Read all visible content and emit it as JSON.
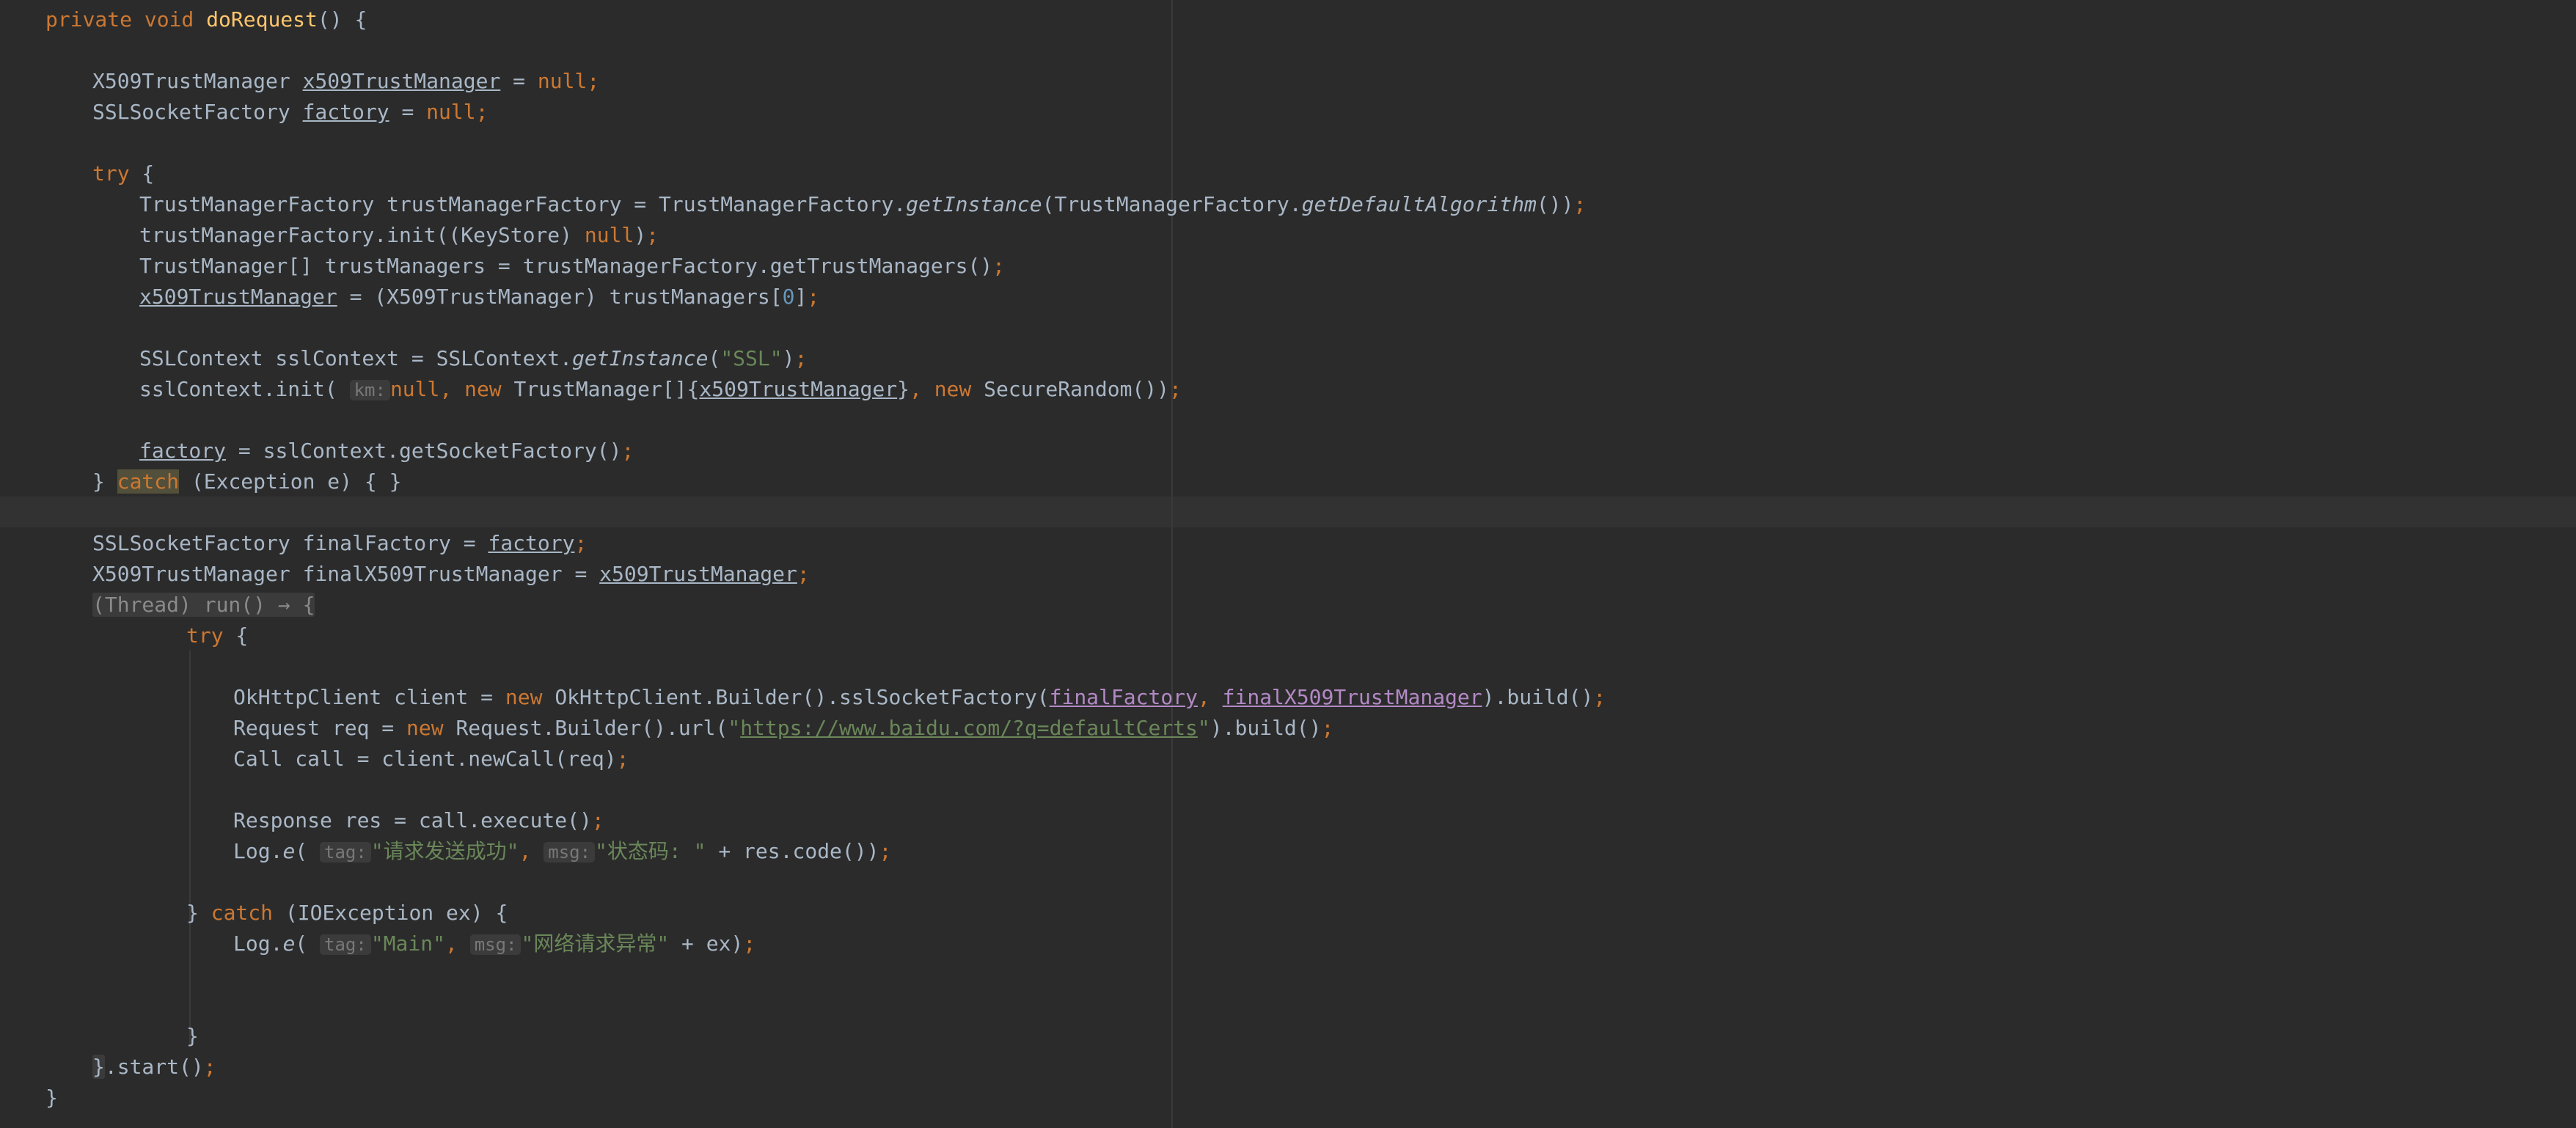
{
  "colors": {
    "background": "#2b2b2b",
    "keyword": "#cc7832",
    "method_decl": "#ffc66d",
    "string": "#6a8759",
    "number": "#6897bb",
    "plain": "#a9b7c6",
    "param_hint": "#787878"
  },
  "code": {
    "l01": {
      "kw": "private void ",
      "fn": "doRequest",
      "rest": "() {"
    },
    "l02": {
      "type": "X509TrustManager ",
      "var": "x509TrustManager",
      "eq": " = ",
      "null": "null",
      "semi": ";"
    },
    "l03": {
      "type": "SSLSocketFactory ",
      "var": "factory",
      "eq": " = ",
      "null": "null",
      "semi": ";"
    },
    "l04": {
      "kw": "try",
      "rest": " {"
    },
    "l05": {
      "a": "TrustManagerFactory trustManagerFactory = TrustManagerFactory.",
      "m1": "getInstance",
      "b": "(TrustManagerFactory.",
      "m2": "getDefaultAlgorithm",
      "c": "())",
      "semi": ";"
    },
    "l06": {
      "a": "trustManagerFactory.init((KeyStore) ",
      "null": "null",
      "b": ")",
      "semi": ";"
    },
    "l07": {
      "a": "TrustManager[] trustManagers = trustManagerFactory.getTrustManagers()",
      "semi": ";"
    },
    "l08": {
      "var": "x509TrustManager",
      "a": " = (X509TrustManager) trustManagers[",
      "num": "0",
      "b": "]",
      "semi": ";"
    },
    "l09": {
      "a": "SSLContext sslContext = SSLContext.",
      "m": "getInstance",
      "b": "(",
      "str": "\"SSL\"",
      "c": ")",
      "semi": ";"
    },
    "l10": {
      "a": "sslContext.init( ",
      "hint": "km:",
      "null": "null",
      "comma1": ", ",
      "new1": "new ",
      "b": "TrustManager[]{",
      "var": "x509TrustManager",
      "c": "}",
      "comma2": ", ",
      "new2": "new ",
      "d": "SecureRandom())",
      "semi": ";"
    },
    "l11": {
      "var": "factory",
      "a": " = sslContext.getSocketFactory()",
      "semi": ";"
    },
    "l12": {
      "a": "} ",
      "kw": "catch",
      "b": " (Exception e) { }"
    },
    "l13": {
      "a": "SSLSocketFactory finalFactory = ",
      "var": "factory",
      "semi": ";"
    },
    "l14": {
      "a": "X509TrustManager finalX509TrustManager = ",
      "var": "x509TrustManager",
      "semi": ";"
    },
    "l15": {
      "fold": "(Thread) run() → {"
    },
    "l16": {
      "kw": "try",
      "rest": " {"
    },
    "l17": {
      "a": "OkHttpClient client = ",
      "new": "new ",
      "b": "OkHttpClient.Builder().sslSocketFactory(",
      "v1": "finalFactory",
      "comma": ", ",
      "v2": "finalX509TrustManager",
      "c": ").build()",
      "semi": ";"
    },
    "l18": {
      "a": "Request req = ",
      "new": "new ",
      "b": "Request.Builder().url(",
      "q1": "\"",
      "url": "https://www.baidu.com/?q=defaultCerts",
      "q2": "\"",
      "c": ").build()",
      "semi": ";"
    },
    "l19": {
      "a": "Call call = client.newCall(req)",
      "semi": ";"
    },
    "l20": {
      "a": "Response res = call.execute()",
      "semi": ";"
    },
    "l21": {
      "a": "Log.",
      "m": "e",
      "b": "( ",
      "hint1": "tag:",
      "s1": "\"请求发送成功\"",
      "comma": ", ",
      "hint2": "msg:",
      "s2": "\"状态码: \"",
      "c": " + res.code())",
      "semi": ";"
    },
    "l22": {
      "a": "} ",
      "kw": "catch",
      "b": " (IOException ex) {"
    },
    "l23": {
      "a": "Log.",
      "m": "e",
      "b": "( ",
      "hint1": "tag:",
      "s1": "\"Main\"",
      "comma": ", ",
      "hint2": "msg:",
      "s2": "\"网络请求异常\"",
      "c": " + ex)",
      "semi": ";"
    },
    "l24": {
      "a": "}"
    },
    "l25": {
      "brace": "}",
      "a": ".start()",
      "semi": ";"
    },
    "l26": {
      "a": "}"
    }
  }
}
